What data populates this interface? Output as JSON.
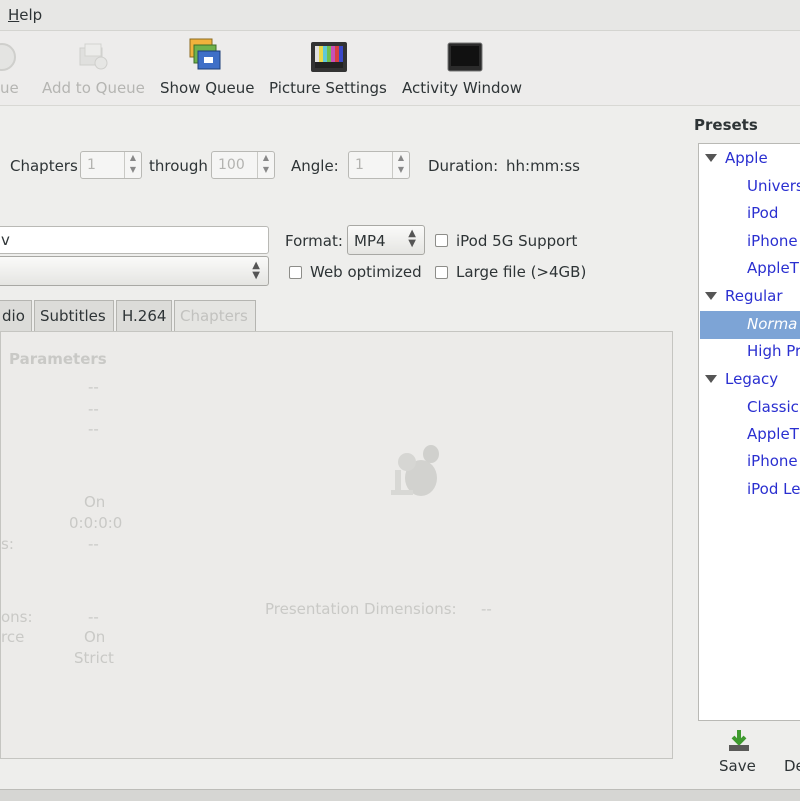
{
  "menu": {
    "help": "Help"
  },
  "toolbar": {
    "queue_partial": "ue",
    "add_to_queue": "Add to Queue",
    "show_queue": "Show Queue",
    "picture_settings": "Picture Settings",
    "activity_window": "Activity Window"
  },
  "source": {
    "chapters_label": "Chapters",
    "chapter_from": "1",
    "through_label": "through",
    "chapter_to": "100",
    "angle_label": "Angle:",
    "angle_value": "1",
    "duration_label": "Duration:",
    "duration_value": "hh:mm:ss"
  },
  "destination": {
    "file_value_partial": "v",
    "format_label": "Format:",
    "format_value": "MP4",
    "ipod_label": "iPod 5G Support",
    "web_optimized_label": "Web optimized",
    "large_file_label": "Large file (>4GB)"
  },
  "tabs": [
    "dio",
    "Subtitles",
    "H.264",
    "Chapters"
  ],
  "picture_panel": {
    "section_title_partial": "Parameters",
    "values": [
      "--",
      "--",
      "--",
      "On",
      "0:0:0:0",
      "--",
      "--",
      "On",
      "Strict"
    ],
    "labels_partial": [
      "s:",
      "ons:",
      "rce"
    ],
    "presentation_label": "Presentation Dimensions:",
    "presentation_value": "--"
  },
  "presets": {
    "title": "Presets",
    "groups": [
      {
        "name": "Apple",
        "items": [
          "Univers",
          "iPod",
          "iPhone",
          "AppleT"
        ]
      },
      {
        "name": "Regular",
        "items": [
          "Norma",
          "High Pr"
        ]
      },
      {
        "name": "Legacy",
        "items": [
          "Classic",
          "AppleT",
          "iPhone",
          "iPod Le"
        ]
      }
    ],
    "save_label": "Save",
    "delete_partial": "De"
  },
  "colors": {
    "selection": "#7da4d6",
    "preset_link": "#2a2fd0"
  }
}
